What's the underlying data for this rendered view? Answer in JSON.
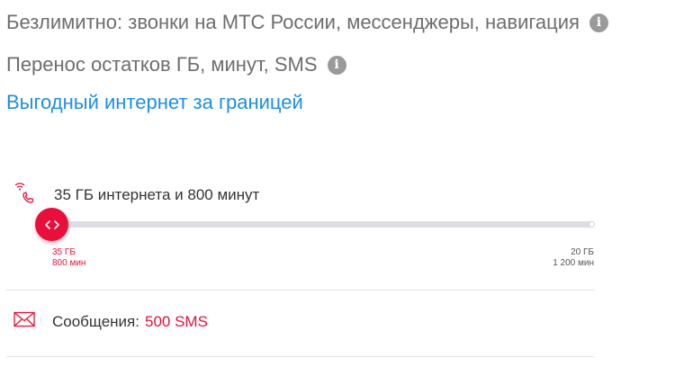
{
  "features": [
    {
      "text": "Безлимитно: звонки на МТС России, мессенджеры, навигация",
      "icon": "info-icon"
    },
    {
      "text": "Перенос остатков ГБ, минут, SMS",
      "icon": "info-icon"
    }
  ],
  "roaming_link": "Выгодный интернет за границей",
  "package": {
    "icon": "wifi-phone-icon",
    "label": "35 ГБ интернета и 800 минут",
    "slider": {
      "thumb_icon": "chevron-left-right-icon",
      "min_gb": "35 ГБ",
      "min_minutes": "800 мин",
      "max_gb": "20 ГБ",
      "max_minutes": "1 200 мин",
      "position": 0
    }
  },
  "sms": {
    "icon": "envelope-icon",
    "label": "Сообщения:",
    "value": "500 SMS"
  },
  "colors": {
    "accent": "#e8103a",
    "link": "#1e8ee5",
    "muted_text": "#6e6e6e",
    "track": "#dcdee3"
  }
}
